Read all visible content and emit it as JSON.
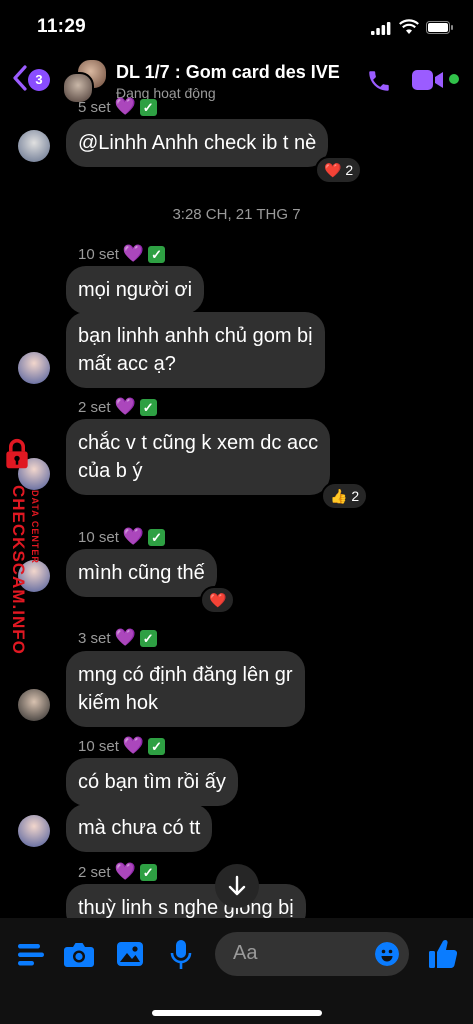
{
  "status_bar": {
    "time": "11:29"
  },
  "header": {
    "unread_count": "3",
    "title": "DL 1/7 : Gom card des IVE",
    "subtitle": "Đang hoạt động"
  },
  "conversation": {
    "top_meta": {
      "sender": "5 set"
    },
    "top_message": {
      "text": "@Linhh Anhh check ib t nè",
      "reaction": "❤️ 2"
    },
    "timestamp": "3:28 CH, 21 THG 7",
    "groups": [
      {
        "meta": "10 set",
        "messages": [
          "mọi người ơi",
          "bạn linhh anhh chủ gom bị\nmất acc ạ?"
        ]
      },
      {
        "meta": "2 set",
        "messages": [
          "chắc v t cũng k xem dc acc\ncủa b ý"
        ],
        "reaction": "👍 2"
      },
      {
        "meta": "10 set",
        "messages": [
          "mình cũng thế"
        ],
        "reaction": "❤️"
      },
      {
        "meta": "3 set",
        "messages": [
          "mng có định đăng lên gr\nkiếm hok"
        ]
      },
      {
        "meta": "10 set",
        "messages": [
          "có bạn tìm rồi ấy",
          "mà chưa có tt"
        ]
      },
      {
        "meta": "2 set",
        "messages": [
          "thuỳ linh s nghe giống bị"
        ]
      }
    ]
  },
  "watermark": {
    "site": "CHECKSCAM.INFO",
    "tagline": "DATA CENTER"
  },
  "composer": {
    "placeholder": "Aa"
  },
  "colors": {
    "accent": "#9b5cff",
    "blue": "#0a7cff",
    "bubble": "#303030",
    "background": "#000000"
  }
}
